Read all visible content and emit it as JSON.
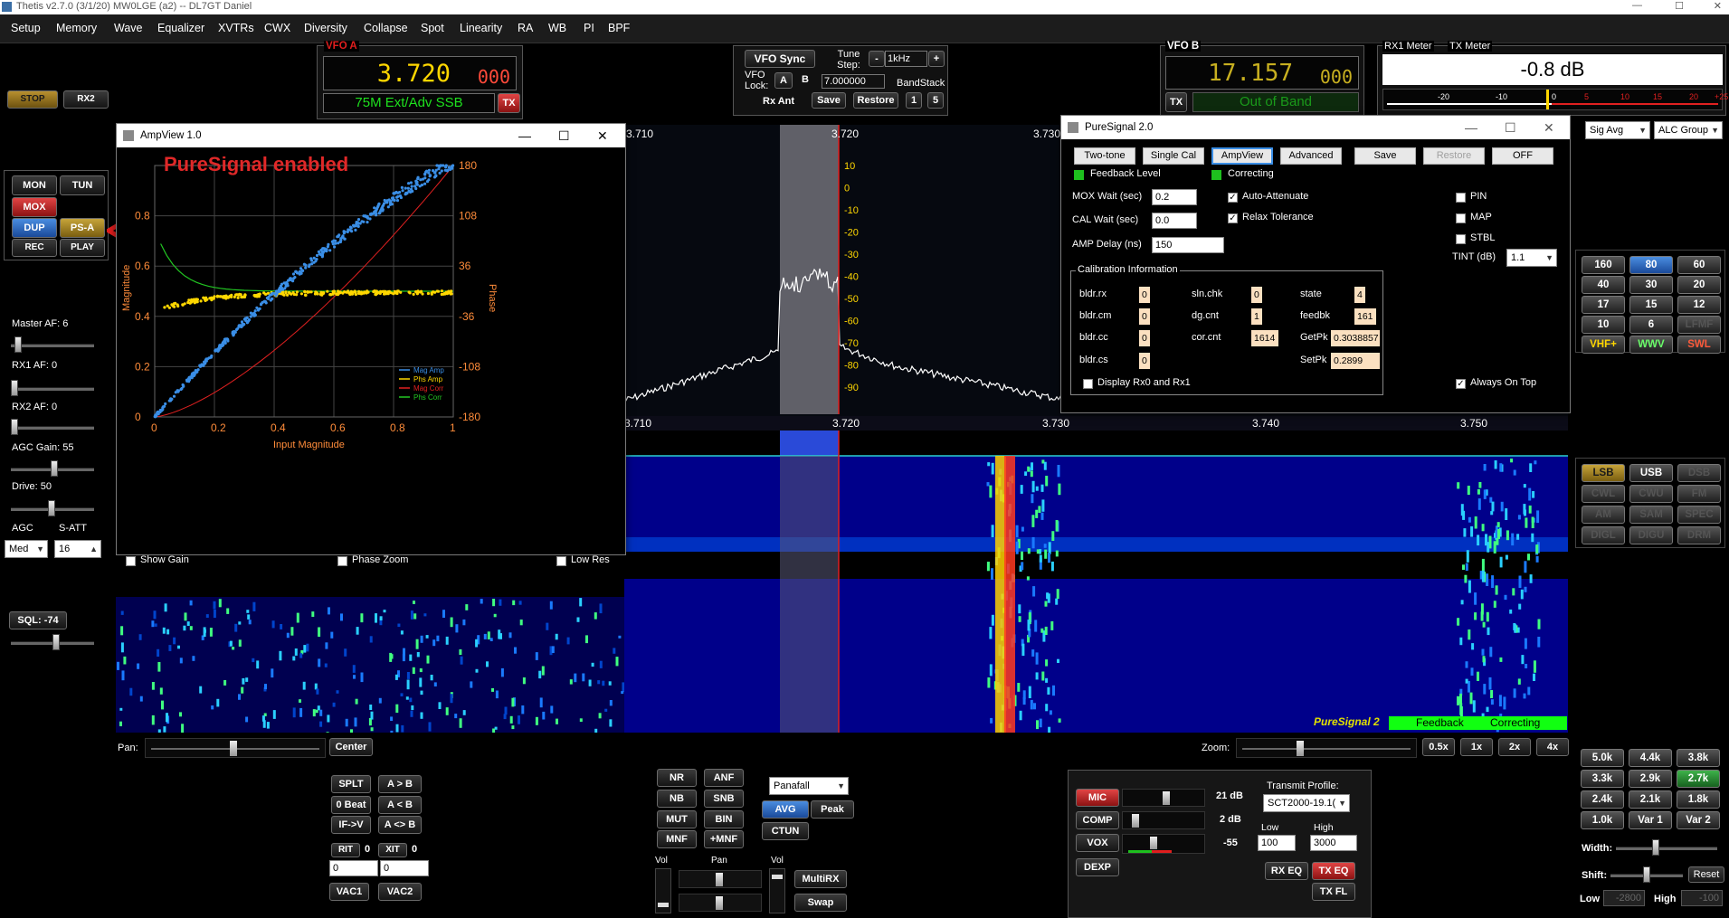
{
  "app": {
    "title": "Thetis v2.7.0 (3/1/20) MW0LGE (a2)  --  DL7GT Daniel"
  },
  "menu": [
    "Setup",
    "Memory",
    "Wave",
    "Equalizer",
    "XVTRs",
    "CWX",
    "Diversity",
    "Collapse",
    "Spot",
    "Linearity",
    "RA",
    "WB",
    "PI",
    "BPF"
  ],
  "left_panel": {
    "stop": "STOP",
    "rx2": "RX2",
    "mon": "MON",
    "tun": "TUN",
    "mox": "MOX",
    "dup": "DUP",
    "psa": "PS-A",
    "rec": "REC",
    "play": "PLAY",
    "master_af": "Master AF:  6",
    "rx1_af": "RX1 AF:  0",
    "rx2_af": "RX2 AF:  0",
    "agc_gain": "AGC Gain:  55",
    "drive": "Drive:  50",
    "agc": "AGC",
    "satt": "S-ATT",
    "agc_mode": "Med",
    "satt_value": "16",
    "sql": "SQL: -74"
  },
  "vfo_a": {
    "label": "VFO A",
    "freq": "3.720",
    "freq_sub": "000",
    "mode": "75M Ext/Adv SSB",
    "tx": "TX"
  },
  "vfo_sync": {
    "btn": "VFO Sync",
    "tune_step": "Tune Step:",
    "step_value": "1kHz",
    "lock": "VFO Lock:",
    "a": "A",
    "b": "B",
    "freq": "7.000000",
    "bandstack": "BandStack",
    "rx_ant": "Rx Ant",
    "save": "Save",
    "restore": "Restore",
    "n1": "1",
    "n2": "5"
  },
  "vfo_b": {
    "label": "VFO B",
    "freq": "17.157",
    "freq_sub": "000",
    "tx": "TX",
    "status": "Out of Band"
  },
  "meters": {
    "rx1": "RX1 Meter",
    "tx": "TX Meter",
    "value": "-0.8 dB",
    "scale": [
      "-20",
      "-10",
      "0",
      "5",
      "10",
      "15",
      "20",
      "+25"
    ],
    "sig_avg": "Sig Avg",
    "alc_group": "ALC Group"
  },
  "ampview": {
    "title": "AmpView 1.0",
    "note": "PureSignal enabled",
    "xlabel": "Input Magnitude",
    "ylabel_left": "Magnitude",
    "ylabel_right": "Phase",
    "x_ticks": [
      "0",
      "0.2",
      "0.4",
      "0.6",
      "0.8",
      "1"
    ],
    "y_ticks": [
      "0",
      "0.2",
      "0.4",
      "0.6",
      "0.8"
    ],
    "phase_ticks": [
      "180",
      "108",
      "36",
      "-36",
      "-108",
      "-180"
    ],
    "legend": [
      {
        "name": "Mag Amp",
        "color": "#3a8ee6"
      },
      {
        "name": "Phs Amp",
        "color": "#ffd700"
      },
      {
        "name": "Mag Corr",
        "color": "#e02020"
      },
      {
        "name": "Phs Corr",
        "color": "#22c722"
      }
    ],
    "show_gain": "Show Gain",
    "phase_zoom": "Phase Zoom",
    "low_res": "Low Res"
  },
  "spectrum": {
    "top_freqs": [
      "3.710",
      "3.720",
      "3.730"
    ],
    "bottom_freqs": [
      "3.710",
      "3.720",
      "3.730",
      "3.740",
      "3.750"
    ],
    "db_ticks": [
      "10",
      "0",
      "-10",
      "-20",
      "-30",
      "-40",
      "-50",
      "-60",
      "-70",
      "-80",
      "-90"
    ],
    "ps_label": "PureSignal 2",
    "feedback": "Feedback",
    "correcting": "Correcting"
  },
  "puresignal": {
    "title": "PureSignal 2.0",
    "buttons": {
      "two_tone": "Two-tone",
      "single_cal": "Single Cal",
      "ampview": "AmpView",
      "advanced": "Advanced",
      "save": "Save",
      "restore": "Restore",
      "off": "OFF"
    },
    "feedback_level": "Feedback Level",
    "correcting": "Correcting",
    "mox_wait": "MOX Wait (sec)",
    "mox_wait_val": "0.2",
    "cal_wait": "CAL Wait (sec)",
    "cal_wait_val": "0.0",
    "amp_delay": "AMP Delay (ns)",
    "amp_delay_val": "150",
    "auto_attenuate": "Auto-Attenuate",
    "relax_tolerance": "Relax Tolerance",
    "pin": "PIN",
    "map": "MAP",
    "stbl": "STBL",
    "tint": "TINT (dB)",
    "tint_val": "1.1",
    "cal_info": "Calibration Information",
    "fields": {
      "bldr_rx": "bldr.rx",
      "bldr_rx_v": "0",
      "bldr_cm": "bldr.cm",
      "bldr_cm_v": "0",
      "bldr_cc": "bldr.cc",
      "bldr_cc_v": "0",
      "bldr_cs": "bldr.cs",
      "bldr_cs_v": "0",
      "sln_chk": "sln.chk",
      "sln_chk_v": "0",
      "dg_cnt": "dg.cnt",
      "dg_cnt_v": "1",
      "cor_cnt": "cor.cnt",
      "cor_cnt_v": "1614",
      "state": "state",
      "state_v": "4",
      "feedbk": "feedbk",
      "feedbk_v": "161",
      "getpk": "GetPk",
      "getpk_v": "0.3038857",
      "setpk": "SetPk",
      "setpk_v": "0.2899"
    },
    "display_rx0_rx1": "Display Rx0 and Rx1",
    "always_on_top": "Always On Top"
  },
  "band_buttons": [
    "160",
    "80",
    "60",
    "40",
    "30",
    "20",
    "17",
    "15",
    "12",
    "10",
    "6",
    "LFMF",
    "VHF+",
    "WWV",
    "SWL"
  ],
  "mode_buttons": [
    "LSB",
    "USB",
    "DSB",
    "CWL",
    "CWU",
    "FM",
    "AM",
    "SAM",
    "SPEC",
    "DIGL",
    "DIGU",
    "DRM"
  ],
  "filter_buttons": [
    "5.0k",
    "4.4k",
    "3.8k",
    "3.3k",
    "2.9k",
    "2.7k",
    "2.4k",
    "2.1k",
    "1.8k",
    "1.0k",
    "Var 1",
    "Var 2"
  ],
  "filter_ctrl": {
    "width": "Width:",
    "shift": "Shift:",
    "reset": "Reset",
    "low": "Low",
    "low_val": "-2800",
    "high": "High",
    "high_val": "-100"
  },
  "bottom": {
    "pan": "Pan:",
    "center": "Center",
    "zoom": "Zoom:",
    "zooms": [
      "0.5x",
      "1x",
      "2x",
      "4x"
    ],
    "splt": "SPLT",
    "a_b": "A > B",
    "beat": "0 Beat",
    "a_lt_b": "A < B",
    "if_v": "IF->V",
    "a_sw_b": "A <> B",
    "rit": "RIT",
    "rit_val": "0",
    "xit": "XIT",
    "xit_val": "0",
    "rit_in": "0",
    "xit_in": "0",
    "vac1": "VAC1",
    "vac2": "VAC2",
    "nr": "NR",
    "anf": "ANF",
    "nb": "NB",
    "snb": "SNB",
    "mut": "MUT",
    "bin": "BIN",
    "mnf": "MNF",
    "pmnf": "+MNF",
    "display_mode": "Panafall",
    "avg": "AVG",
    "peak": "Peak",
    "ctun": "CTUN",
    "vol1": "Vol",
    "pan2": "Pan",
    "vol2": "Vol",
    "multirx": "MultiRX",
    "swap": "Swap"
  },
  "tx_panel": {
    "mic": "MIC",
    "mic_val": "21 dB",
    "comp": "COMP",
    "comp_val": "2 dB",
    "vox": "VOX",
    "vox_val": "-55",
    "dexp": "DEXP",
    "profile_label": "Transmit Profile:",
    "profile": "SCT2000-19.1(",
    "low": "Low",
    "low_val": "100",
    "high": "High",
    "high_val": "3000",
    "rx_eq": "RX EQ",
    "tx_eq": "TX EQ",
    "tx_fl": "TX FL"
  }
}
